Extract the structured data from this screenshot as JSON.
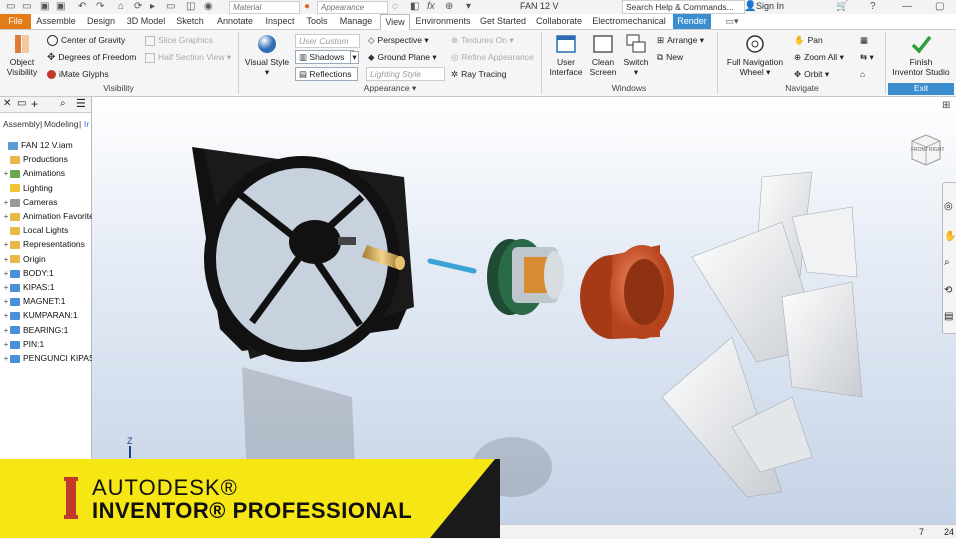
{
  "qat": {
    "material_placeholder": "Material",
    "appearance_placeholder": "Appearance",
    "doc_title": "FAN 12 V",
    "help_search": "Search Help & Commands...",
    "sign_in": "Sign In"
  },
  "tabs": [
    "File",
    "Assemble",
    "Design",
    "3D Model",
    "Sketch",
    "Annotate",
    "Inspect",
    "Tools",
    "Manage",
    "View",
    "Environments",
    "Get Started",
    "Collaborate",
    "Electromechanical",
    "Render"
  ],
  "active_tab": "View",
  "ribbon": {
    "visibility": {
      "title": "Visibility",
      "object_visibility_1": "Object",
      "object_visibility_2": "Visibility",
      "center_of_gravity": "Center of Gravity",
      "degrees_of_freedom": "Degrees of Freedom",
      "imate_glyphs": "iMate Glyphs",
      "slice_graphics": "Slice Graphics",
      "half_section_view": "Half Section View"
    },
    "appearance": {
      "title": "Appearance",
      "visual_style": "Visual Style",
      "user_custom": "User Custom",
      "shadows": "Shadows",
      "reflections": "Reflections",
      "perspective": "Perspective",
      "ground_plane": "Ground Plane",
      "lighting_style": "Lighting Style",
      "textures_on": "Textures On",
      "refine_appearance": "Refine Appearance",
      "ray_tracing": "Ray Tracing"
    },
    "windows": {
      "title": "Windows",
      "user_interface_1": "User",
      "user_interface_2": "Interface",
      "clean_screen_1": "Clean",
      "clean_screen_2": "Screen",
      "switch": "Switch",
      "arrange": "Arrange",
      "new": "New"
    },
    "navigate": {
      "title": "Navigate",
      "full_nav_1": "Full Navigation",
      "full_nav_2": "Wheel",
      "pan": "Pan",
      "zoom_all": "Zoom All",
      "orbit": "Orbit"
    },
    "exit": {
      "title": "Exit",
      "finish_1": "Finish",
      "finish_2": "Inventor Studio"
    }
  },
  "browser": {
    "tab_assembly": "Assembly",
    "tab_modeling": "Modeling",
    "tab_extra": "Ir",
    "items": [
      {
        "label": "FAN 12 V.iam",
        "color": "#5b9bd5",
        "plus": ""
      },
      {
        "label": "Productions",
        "color": "#e8b84a",
        "plus": ""
      },
      {
        "label": "Animations",
        "color": "#6aa84f",
        "plus": "+"
      },
      {
        "label": "Lighting",
        "color": "#f1c232",
        "plus": ""
      },
      {
        "label": "Cameras",
        "color": "#999999",
        "plus": "+"
      },
      {
        "label": "Animation Favorites",
        "color": "#e8b84a",
        "plus": "+"
      },
      {
        "label": "Local Lights",
        "color": "#e8b84a",
        "plus": ""
      },
      {
        "label": "Representations",
        "color": "#e8b84a",
        "plus": "+"
      },
      {
        "label": "Origin",
        "color": "#e8b84a",
        "plus": "+"
      },
      {
        "label": "BODY:1",
        "color": "#4a90d9",
        "plus": "+"
      },
      {
        "label": "KIPAS:1",
        "color": "#4a90d9",
        "plus": "+"
      },
      {
        "label": "MAGNET:1",
        "color": "#4a90d9",
        "plus": "+"
      },
      {
        "label": "KUMPARAN:1",
        "color": "#4a90d9",
        "plus": "+"
      },
      {
        "label": "BEARING:1",
        "color": "#4a90d9",
        "plus": "+"
      },
      {
        "label": "PIN:1",
        "color": "#4a90d9",
        "plus": "+"
      },
      {
        "label": "PENGUNCI KIPAS:1",
        "color": "#4a90d9",
        "plus": "+"
      }
    ]
  },
  "viewcube": {
    "face_front": "FRONT",
    "face_right": "RIGHT"
  },
  "axis_label": "Z",
  "status": {
    "a": "7",
    "b": "24"
  },
  "banner": {
    "line1": "AUTODESK®",
    "line2": "INVENTOR® PROFESSIONAL",
    "accent": "#f5e614"
  }
}
